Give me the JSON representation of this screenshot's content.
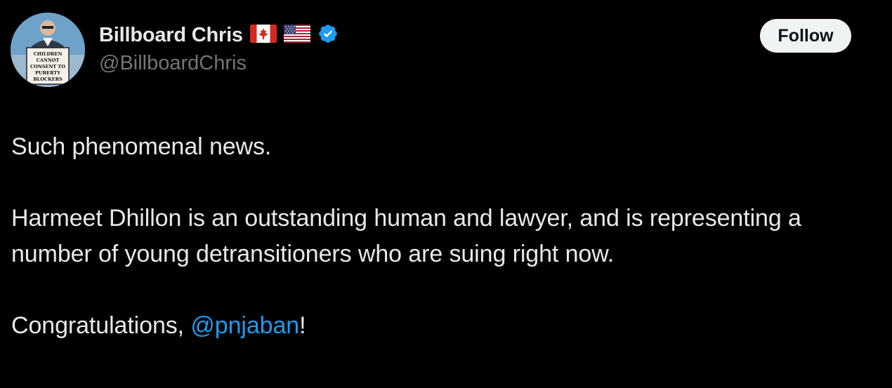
{
  "author": {
    "display_name": "Billboard Chris",
    "handle": "@BillboardChris",
    "flags": [
      "canada-flag",
      "usa-flag"
    ],
    "verified_icon": "verified-badge-icon",
    "avatar_sign_text": [
      "CHILDREN",
      "CANNOT",
      "CONSENT TO",
      "PUBERTY",
      "BLOCKERS"
    ]
  },
  "actions": {
    "follow_label": "Follow"
  },
  "tweet": {
    "paragraph_1": "Such phenomenal news.",
    "paragraph_2": "Harmeet Dhillon is an outstanding human and lawyer, and is representing a number of young detransitioners who are suing right now.",
    "paragraph_3_prefix": "Congratulations, ",
    "mention": "@pnjaban",
    "paragraph_3_suffix": "!"
  },
  "colors": {
    "background": "#000000",
    "text_primary": "#e7e9ea",
    "text_secondary": "#71767b",
    "link": "#1d9bf0",
    "verified": "#1d9bf0",
    "follow_button_bg": "#eff3f4"
  }
}
